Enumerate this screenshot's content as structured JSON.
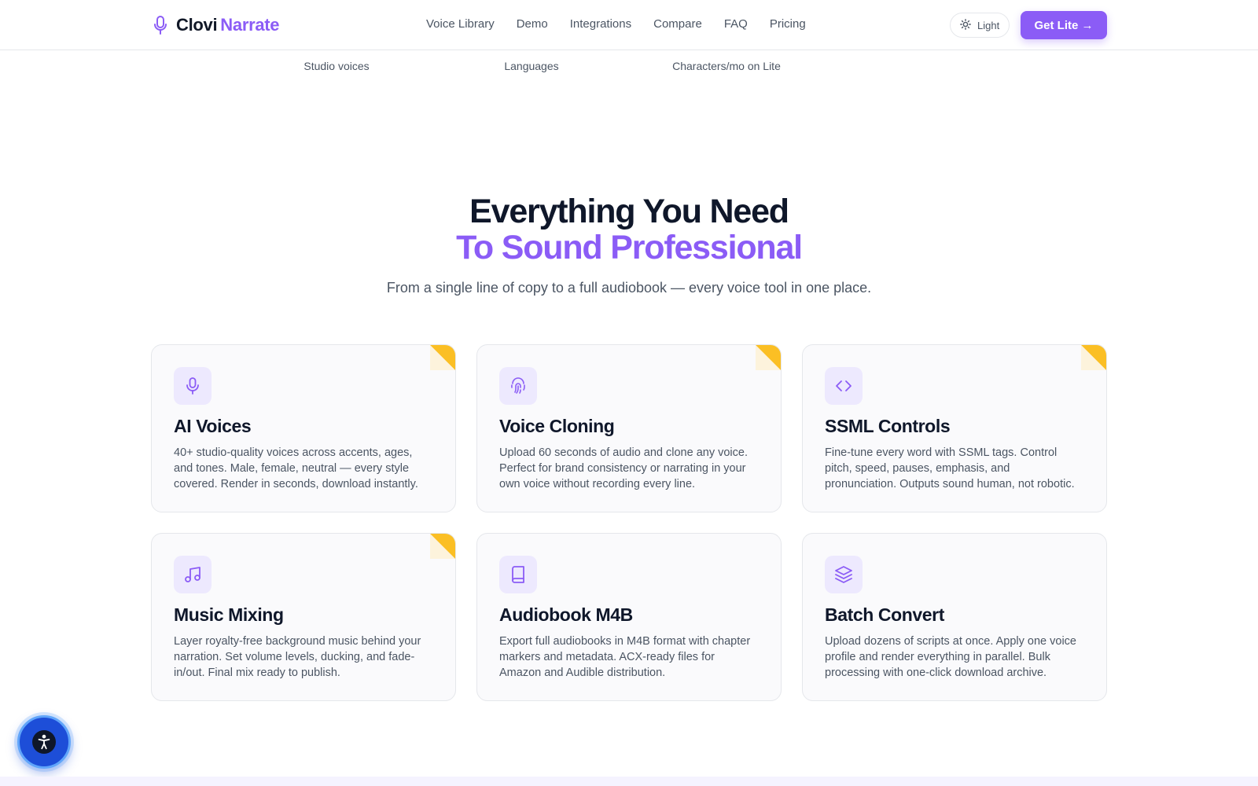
{
  "brand": {
    "name_part1": "Clovi",
    "name_part2": "Narrate",
    "icon": "microphone-icon",
    "accent": "#8b5cf6"
  },
  "nav": {
    "links": [
      "Voice Library",
      "Demo",
      "Integrations",
      "Compare",
      "FAQ",
      "Pricing"
    ],
    "theme_toggle": {
      "label": "Light",
      "icon": "sun-icon"
    },
    "cta_label": "Get Lite →"
  },
  "stats": [
    "Studio voices",
    "Languages",
    "Characters/mo on Lite"
  ],
  "section": {
    "title_line1": "Everything You Need",
    "title_line2": "To Sound Professional",
    "subtitle": "From a single line of copy to a full audiobook — every voice tool in one place."
  },
  "features": [
    {
      "title": "AI Voices",
      "desc": "40+ studio-quality voices across accents, ages, and tones. Male, female, neutral — every style covered. Render in seconds, download instantly.",
      "icon": "microphone-icon",
      "corner_badge": true
    },
    {
      "title": "Voice Cloning",
      "desc": "Upload 60 seconds of audio and clone any voice. Perfect for brand consistency or narrating in your own voice without recording every line.",
      "icon": "fingerprint-icon",
      "corner_badge": true
    },
    {
      "title": "SSML Controls",
      "desc": "Fine-tune every word with SSML tags. Control pitch, speed, pauses, emphasis, and pronunciation. Outputs sound human, not robotic.",
      "icon": "code-icon",
      "corner_badge": true
    },
    {
      "title": "Music Mixing",
      "desc": "Layer royalty-free background music behind your narration. Set volume levels, ducking, and fade-in/out. Final mix ready to publish.",
      "icon": "music-note-icon",
      "corner_badge": true
    },
    {
      "title": "Audiobook M4B",
      "desc": "Export full audiobooks in M4B format with chapter markers and metadata. ACX-ready files for Amazon and Audible distribution.",
      "icon": "book-icon",
      "corner_badge": false
    },
    {
      "title": "Batch Convert",
      "desc": "Upload dozens of scripts at once. Apply one voice profile and render everything in parallel. Bulk processing with one-click download archive.",
      "icon": "layers-icon",
      "corner_badge": false
    }
  ],
  "accessibility_button": {
    "icon": "accessibility-icon"
  },
  "colors": {
    "corner_yellow": "#fbbf24",
    "icon_bg": "#ede9fe"
  }
}
